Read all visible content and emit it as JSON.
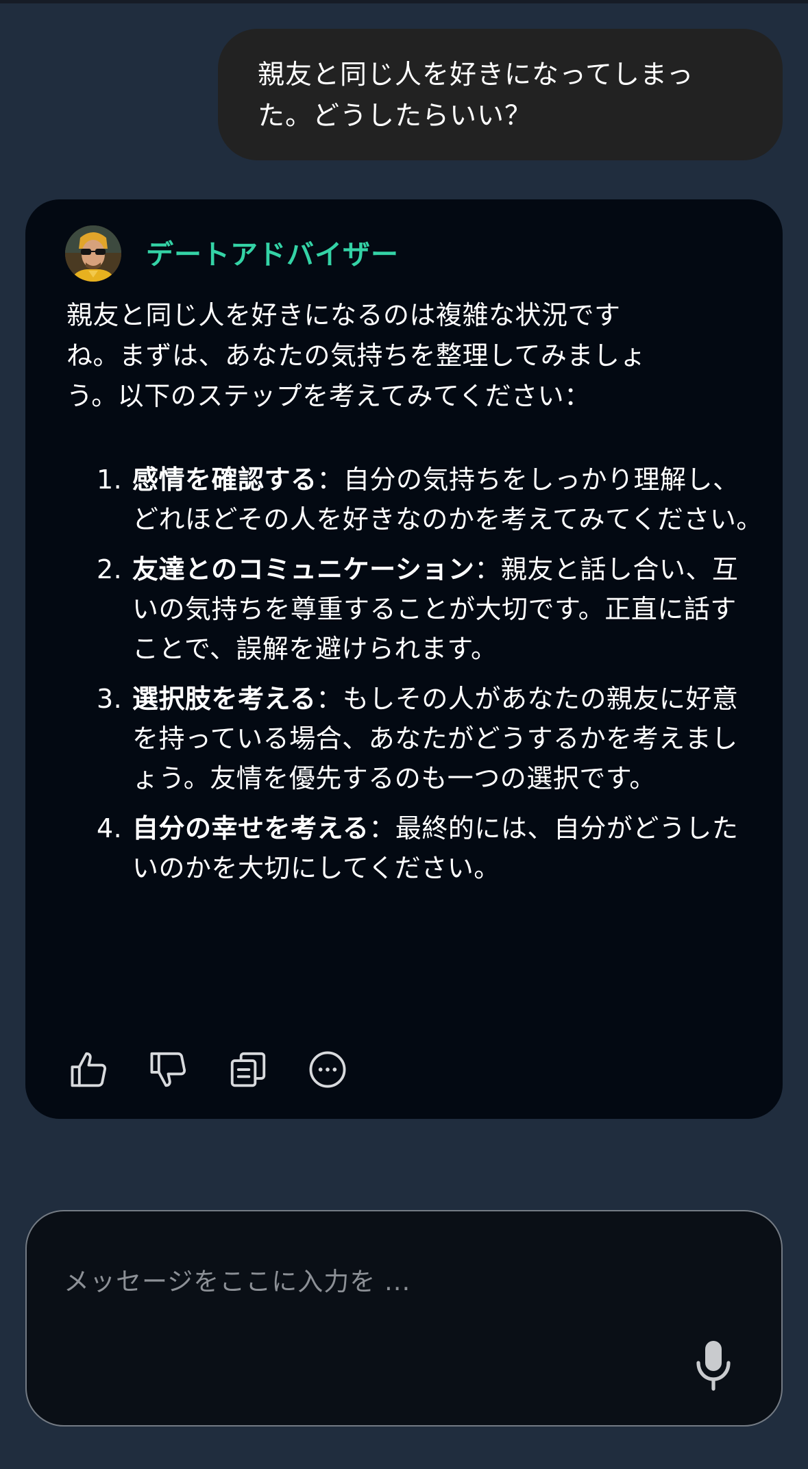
{
  "user_message": {
    "line1": "親友と同じ人を好きになってしまっ",
    "line2": "た。どうしたらいい？"
  },
  "bot": {
    "name": "デートアドバイザー",
    "avatar_icon": "person-with-sunglasses-avatar",
    "intro": {
      "line1": "親友と同じ人を好きになるのは複雑な状況です",
      "line2": "ね。まずは、あなたの気持ちを整理してみましょ",
      "line3": "う。以下のステップを考えてみてください："
    },
    "steps": [
      {
        "num": "1.",
        "title": "感情を確認する",
        "body": "：自分の気持ちをしっかり理解し、どれほどその人を好きなのかを考えてみてください。"
      },
      {
        "num": "2.",
        "title": "友達とのコミュニケーション",
        "body": "：親友と話し合い、互いの気持ちを尊重することが大切です。正直に話すことで、誤解を避けられます。"
      },
      {
        "num": "3.",
        "title": "選択肢を考える",
        "body": "：もしその人があなたの親友に好意を持っている場合、あなたがどうするかを考えましょう。友情を優先するのも一つの選択です。"
      },
      {
        "num": "4.",
        "title": "自分の幸せを考える",
        "body": "：最終的には、自分がどうしたいのかを大切にしてください。"
      }
    ],
    "actions": [
      "thumbs-up-icon",
      "thumbs-down-icon",
      "copy-icon",
      "more-icon"
    ]
  },
  "composer": {
    "placeholder": "メッセージをここに入力を ...",
    "mic_icon": "microphone-icon"
  },
  "colors": {
    "background": "#202d3e",
    "user_bubble": "#222222",
    "bot_card": "#030912",
    "accent_name": "#34d3a6",
    "input_bg": "#0a0f16",
    "input_border": "#747b84"
  }
}
